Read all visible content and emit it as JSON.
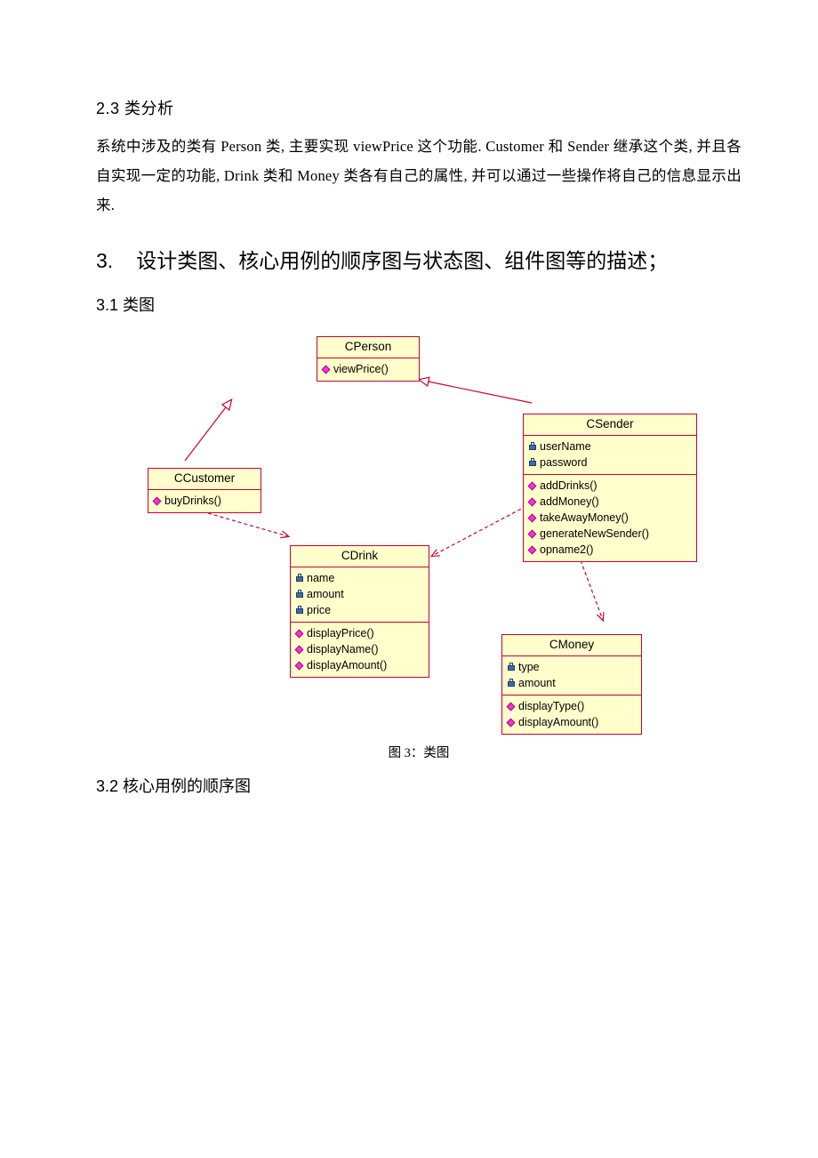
{
  "sections": {
    "s23_title": "2.3 类分析",
    "s23_body": "系统中涉及的类有 Person 类, 主要实现 viewPrice 这个功能. Customer 和 Sender 继承这个类, 并且各自实现一定的功能, Drink 类和 Money 类各有自己的属性, 并可以通过一些操作将自己的信息显示出来.",
    "s3_number": "3.",
    "s3_title": "设计类图、核心用例的顺序图与状态图、组件图等的描述；",
    "s31_title": "3.1 类图",
    "s32_title": "3.2 核心用例的顺序图",
    "figure_caption": "图 3：类图"
  },
  "diagram": {
    "classes": [
      {
        "id": "CPerson",
        "name": "CPerson",
        "attributes": [],
        "methods": [
          {
            "name": "viewPrice()",
            "visibility": "public"
          }
        ]
      },
      {
        "id": "CSender",
        "name": "CSender",
        "attributes": [
          {
            "name": "userName",
            "visibility": "public"
          },
          {
            "name": "password",
            "visibility": "public"
          }
        ],
        "methods": [
          {
            "name": "addDrinks()",
            "visibility": "public"
          },
          {
            "name": "addMoney()",
            "visibility": "public"
          },
          {
            "name": "takeAwayMoney()",
            "visibility": "public"
          },
          {
            "name": "generateNewSender()",
            "visibility": "public"
          },
          {
            "name": "opname2()",
            "visibility": "public"
          }
        ]
      },
      {
        "id": "CCustomer",
        "name": "CCustomer",
        "attributes": [],
        "methods": [
          {
            "name": "buyDrinks()",
            "visibility": "public"
          }
        ]
      },
      {
        "id": "CDrink",
        "name": "CDrink",
        "attributes": [
          {
            "name": "name",
            "visibility": "private"
          },
          {
            "name": "amount",
            "visibility": "private"
          },
          {
            "name": "price",
            "visibility": "private"
          }
        ],
        "methods": [
          {
            "name": "displayPrice()",
            "visibility": "public"
          },
          {
            "name": "displayName()",
            "visibility": "public"
          },
          {
            "name": "displayAmount()",
            "visibility": "public"
          }
        ]
      },
      {
        "id": "CMoney",
        "name": "CMoney",
        "attributes": [
          {
            "name": "type",
            "visibility": "private"
          },
          {
            "name": "amount",
            "visibility": "private"
          }
        ],
        "methods": [
          {
            "name": "displayType()",
            "visibility": "public"
          },
          {
            "name": "displayAmount()",
            "visibility": "public"
          }
        ]
      }
    ],
    "relations": [
      {
        "from": "CCustomer",
        "to": "CPerson",
        "type": "generalization"
      },
      {
        "from": "CSender",
        "to": "CPerson",
        "type": "generalization"
      },
      {
        "from": "CCustomer",
        "to": "CDrink",
        "type": "dependency"
      },
      {
        "from": "CSender",
        "to": "CDrink",
        "type": "dependency"
      },
      {
        "from": "CSender",
        "to": "CMoney",
        "type": "dependency"
      }
    ],
    "colors": {
      "box_fill": "#ffffcc",
      "box_border": "#cc0033",
      "edge": "#cc0033",
      "private_glyph": "#4169b0",
      "public_attr_glyph": "#33cccc",
      "method_glyph": "#ff33cc"
    }
  }
}
